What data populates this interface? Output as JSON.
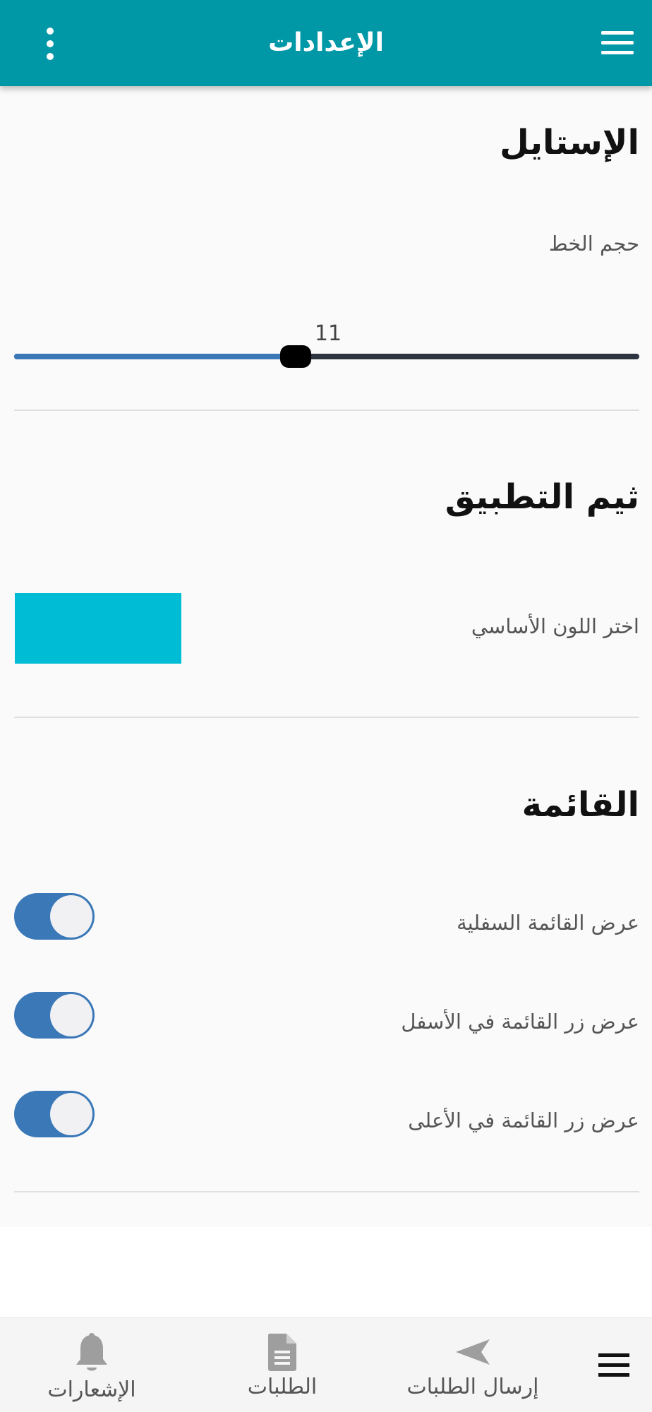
{
  "header": {
    "title": "الإعدادات",
    "menu_icon": "hamburger-menu-icon",
    "more_icon": "more-vertical-icon",
    "background_color": "#0097a7"
  },
  "style_section": {
    "title": "الإستايل",
    "font_size_label": "حجم الخط",
    "font_size_value": "11",
    "slider_fraction": 0.45,
    "slider_active_color": "#3a78b8",
    "slider_thumb_color": "#000000"
  },
  "theme_section": {
    "title": "ثيم التطبيق",
    "primary_color_label": "اختر اللون الأساسي",
    "primary_color": "#00bcd4"
  },
  "menu_section": {
    "title": "القائمة",
    "toggles": [
      {
        "label": "عرض القائمة السفلية",
        "checked": true
      },
      {
        "label": "عرض زر القائمة في الأسفل",
        "checked": true
      },
      {
        "label": "عرض زر القائمة في الأعلى",
        "checked": true
      }
    ],
    "toggle_on_color": "#3a78b8"
  },
  "bottom_nav": {
    "menu_icon": "hamburger-menu-icon",
    "items": [
      {
        "label": "إرسال الطلبات",
        "icon": "send-icon"
      },
      {
        "label": "الطلبات",
        "icon": "document-icon"
      },
      {
        "label": "الإشعارات",
        "icon": "bell-icon"
      }
    ]
  }
}
